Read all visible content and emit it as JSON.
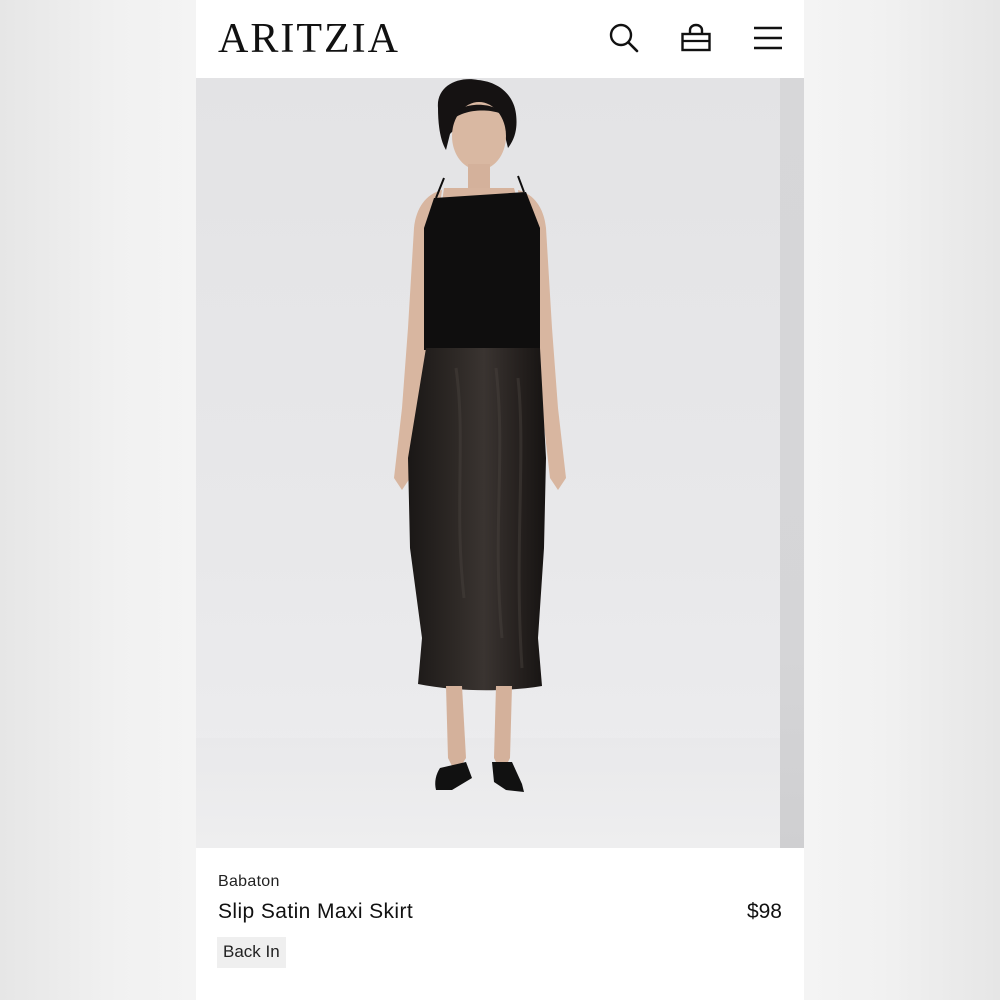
{
  "header": {
    "logo": "ARITZIA",
    "icons": [
      "search-icon",
      "shopping-bag-icon",
      "menu-icon"
    ]
  },
  "product": {
    "brand": "Babaton",
    "name": "Slip Satin Maxi Skirt",
    "price": "$98",
    "badge": "Back In"
  },
  "colors": {
    "background": "#ffffff",
    "text": "#111111",
    "badge_bg": "#efefef",
    "photo_bg": "#e6e6e8"
  }
}
